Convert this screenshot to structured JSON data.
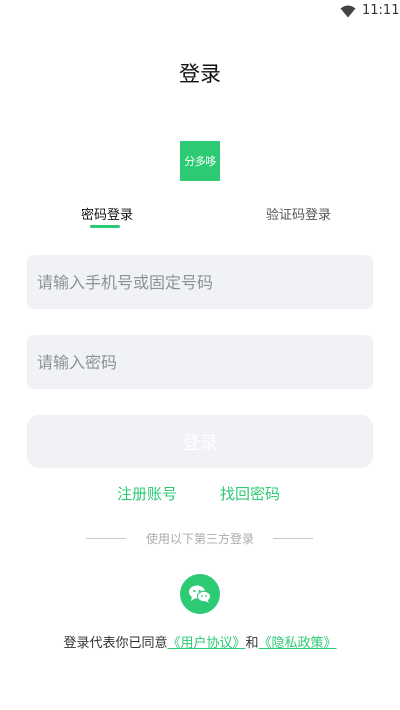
{
  "status_bar": {
    "time": "11:11",
    "wifi_icon": "wifi-icon"
  },
  "page": {
    "title": "登录"
  },
  "logo": {
    "text": "分多哆",
    "color": "#2dca74"
  },
  "tabs": [
    {
      "label": "密码登录",
      "active": true
    },
    {
      "label": "验证码登录",
      "active": false
    }
  ],
  "form": {
    "phone_placeholder": "请输入手机号或固定号码",
    "phone_value": "",
    "password_placeholder": "请输入密码",
    "password_value": "",
    "login_label": "登录"
  },
  "links": {
    "register": "注册账号",
    "forgot": "找回密码"
  },
  "third_party": {
    "label": "使用以下第三方登录",
    "icon": "wechat-icon"
  },
  "agreement": {
    "prefix": "登录代表你已同意",
    "user_agreement": "《用户协议》",
    "and": "和",
    "privacy_policy": "《隐私政策》"
  },
  "colors": {
    "accent": "#2dca74",
    "field_bg": "#f0f2f5"
  }
}
